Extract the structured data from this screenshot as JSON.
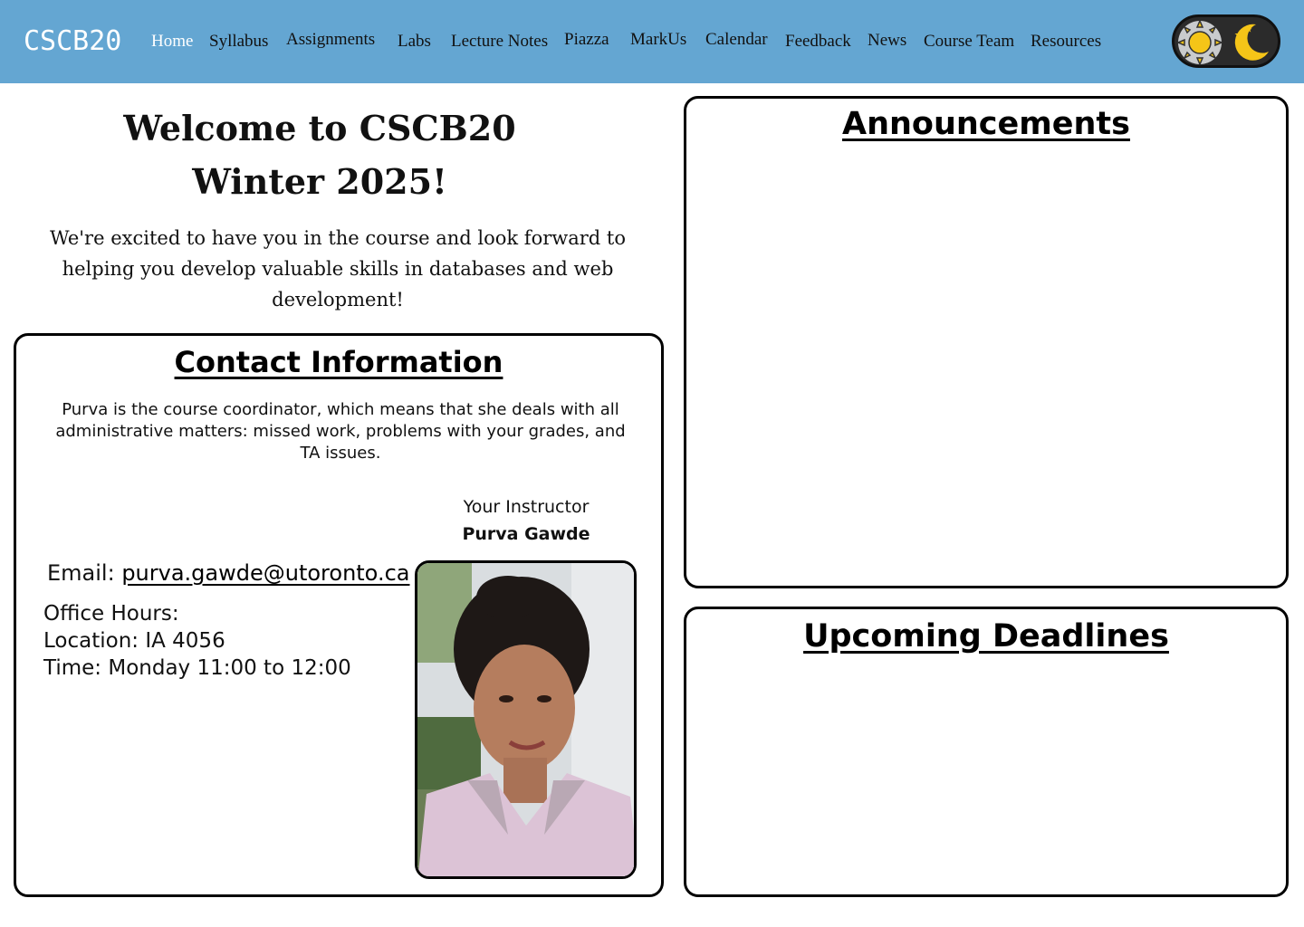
{
  "header": {
    "brand": "CSCB20",
    "nav": [
      {
        "label": "Home",
        "active": true
      },
      {
        "label": "Syllabus"
      },
      {
        "label": "Assignments"
      },
      {
        "label": "Labs"
      },
      {
        "label": "Lecture Notes"
      },
      {
        "label": "Piazza"
      },
      {
        "label": "MarkUs"
      },
      {
        "label": "Calendar"
      },
      {
        "label": "Feedback"
      },
      {
        "label": "News"
      },
      {
        "label": "Course Team"
      },
      {
        "label": "Resources"
      }
    ],
    "theme_toggle": {
      "light_icon": "sun-icon",
      "dark_icon": "moon-icon",
      "selected": "light"
    },
    "colors": {
      "bar": "#64a6d2",
      "active_link": "#ffffff"
    }
  },
  "welcome": {
    "title_line1": "Welcome to CSCB20",
    "title_line2": "Winter 2025!",
    "text": "We're excited to have you in the course and look forward to helping you develop valuable skills in databases and web development!"
  },
  "contact": {
    "title": "Contact Information",
    "description": "Purva is the course coordinator, which means that she deals with all administrative matters: missed work, problems with your grades, and TA issues.",
    "instructor_label": "Your Instructor",
    "instructor_name": "Purva Gawde",
    "email_label": "Email:",
    "email": "purva.gawde@utoronto.ca",
    "office_hours_label": "Office Hours:",
    "location": "Location: IA 4056",
    "time": "Time: Monday 11:00 to 12:00"
  },
  "announcements": {
    "title": "Announcements"
  },
  "deadlines": {
    "title": "Upcoming Deadlines"
  }
}
